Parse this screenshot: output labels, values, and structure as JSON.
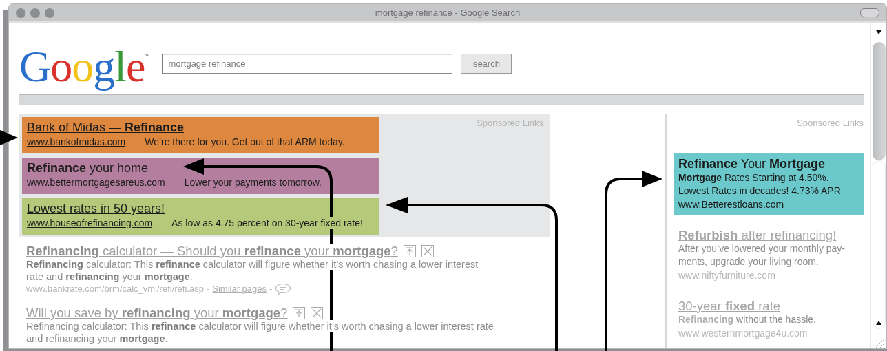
{
  "window": {
    "title": "mortgage refinance - Google Search"
  },
  "logo": {
    "text": "Google",
    "mark": "™"
  },
  "search": {
    "value": "mortgage refinance",
    "button": "search"
  },
  "top_ads": {
    "label": "Sponsored Links",
    "ads": [
      {
        "title": "Bank of Midas — **Refinance**",
        "url": "www.bankofmidas.com",
        "text": "We’re there for you. Get out of that ARM today.",
        "color": "#de883f"
      },
      {
        "title": "**Refinance** your home",
        "url": "www.bettermortgagesareus.com",
        "text": "Lower your payments tomorrow.",
        "color": "#b47e9e"
      },
      {
        "title": "Lowest rates in 50 years!",
        "url": "www.houseofrefinancing.com",
        "text": "As low as 4.75 percent on 30-year fixed rate!",
        "color": "#b5c97a"
      }
    ]
  },
  "results": [
    {
      "title": "**Refinancing** calculator — Should you **refinance** your **mortgage**?",
      "lines": [
        "**Refinancing** calculator: This **refinance** calculator will figure whether it’s worth chasing a lower interest",
        "rate and **refinancing** your **mortgage**."
      ],
      "url": "www.bankrate.com/brm/calc_vml/refi/refi.asp",
      "sep": "-",
      "similar": "Similar pages",
      "sep2": "-"
    },
    {
      "title": "Will you save by **refinancing** your **mortgage**?",
      "lines": [
        "Refinancing calculator: This **refinance** calculator will figure whether it’s worth chasing a lower interest rate",
        "and refinancing your **mortgage**."
      ]
    }
  ],
  "side_ads": {
    "label": "Sponsored Links",
    "ads": [
      {
        "kind": "featured",
        "color": "#6cc9cb",
        "title": "**Refinance** Your **Mortgage**",
        "lines": [
          "**Mortgage** Rates Starting at 4.50%.",
          "Lowest Rates in decades! 4.73% APR"
        ],
        "url": "www.Betterestloans.com"
      },
      {
        "kind": "plain",
        "title": "**Refurbish** after refinancing!",
        "lines": [
          "After you’ve lowered your monthly pay-",
          "ments, upgrade your living room."
        ],
        "url": "www.niftyfurniture.com"
      },
      {
        "kind": "plain",
        "title": "30-year **fixed** rate",
        "lines": [
          "**Refinancing** without the hassle."
        ],
        "url": "www.westernmortgage4u.com"
      }
    ]
  }
}
